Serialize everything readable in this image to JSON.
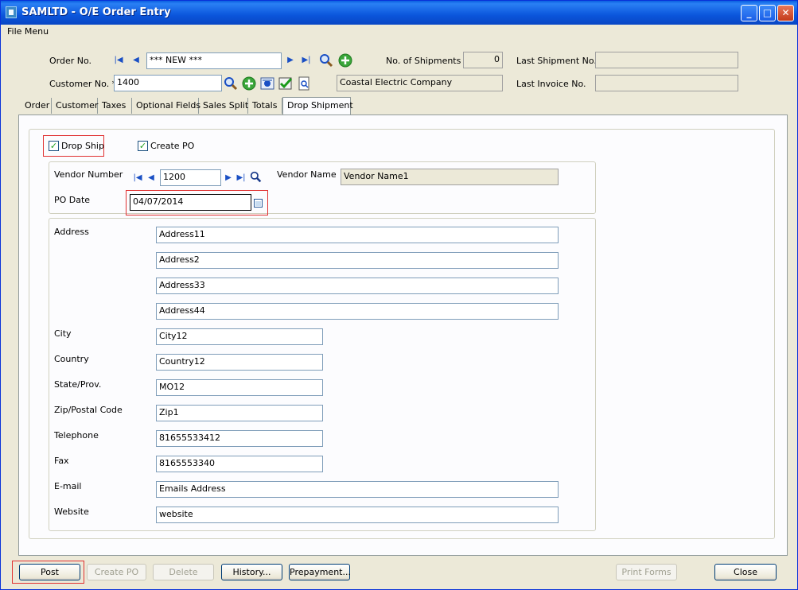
{
  "window": {
    "title": "SAMLTD - O/E Order Entry"
  },
  "menu": {
    "file_menu": "File Menu"
  },
  "header": {
    "order_no_label": "Order No.",
    "order_no_value": "*** NEW ***",
    "customer_no_label": "Customer No. *",
    "customer_no_value": "1400",
    "customer_name": "Coastal Electric Company",
    "shipments_label": "No. of Shipments",
    "shipments_value": "0",
    "last_shipment_label": "Last Shipment No.",
    "last_shipment_value": "",
    "last_invoice_label": "Last Invoice No.",
    "last_invoice_value": ""
  },
  "tabs": [
    "Order",
    "Customer",
    "Taxes",
    "Optional Fields",
    "Sales Split",
    "Totals",
    "Drop Shipment"
  ],
  "drop_ship": {
    "drop_ship_label": "Drop Ship",
    "drop_ship_checked": true,
    "create_po_label": "Create PO",
    "create_po_checked": true,
    "vendor_number_label": "Vendor Number",
    "vendor_number_value": "1200",
    "vendor_name_label": "Vendor Name",
    "vendor_name_value": "Vendor Name1",
    "po_date_label": "PO Date",
    "po_date_value": "04/07/2014",
    "address_label": "Address",
    "address_lines": [
      "Address11",
      "Address2",
      "Address33",
      "Address44"
    ],
    "city_label": "City",
    "city_value": "City12",
    "country_label": "Country",
    "country_value": "Country12",
    "state_label": "State/Prov.",
    "state_value": "MO12",
    "zip_label": "Zip/Postal Code",
    "zip_value": "Zip1",
    "telephone_label": "Telephone",
    "telephone_value": "81655533412",
    "fax_label": "Fax",
    "fax_value": "8165553340",
    "email_label": "E-mail",
    "email_value": "Emails Address",
    "website_label": "Website",
    "website_value": "website"
  },
  "buttons": {
    "post": "Post",
    "create_po": "Create PO",
    "delete": "Delete",
    "history": "History...",
    "prepayment": "Prepayment...",
    "print_forms": "Print Forms",
    "close": "Close"
  },
  "colors": {
    "titlebar": "#0b56dc",
    "highlight": "#e03030",
    "panel": "#fcfcfe"
  }
}
